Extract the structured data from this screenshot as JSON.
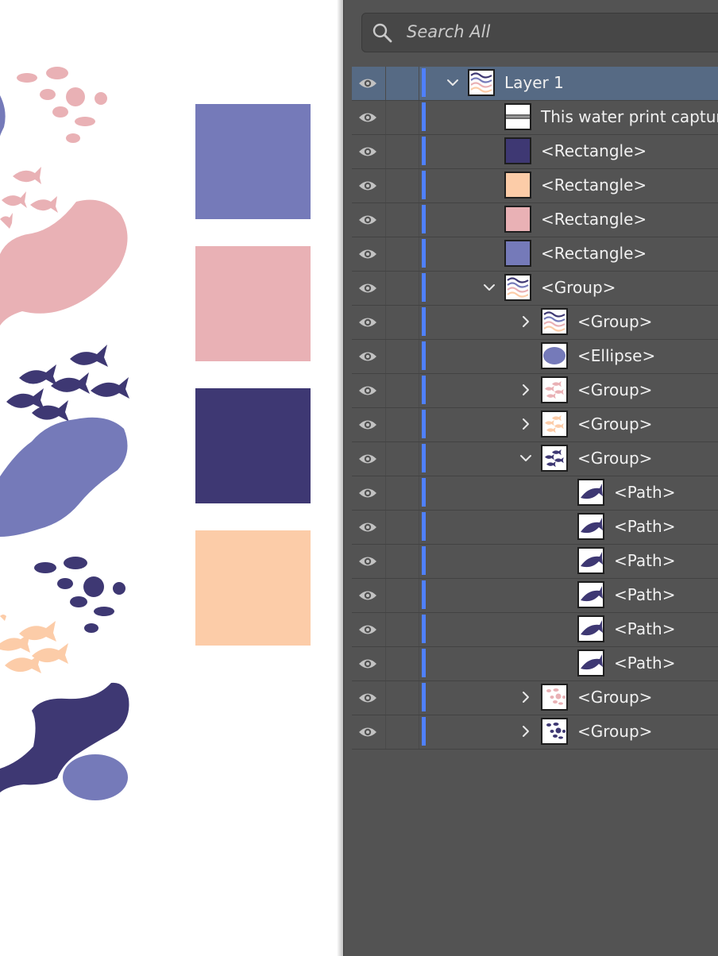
{
  "colors": {
    "periwinkle": "#757ab9",
    "pink": "#e9b1b5",
    "navy": "#3e3873",
    "peach": "#fccca8",
    "panel_bg": "#535353",
    "selection": "#566a84",
    "layer_bar": "#4f80ff"
  },
  "canvas": {
    "swatches": [
      "periwinkle",
      "pink",
      "navy",
      "peach"
    ]
  },
  "layers_panel": {
    "search_placeholder": "Search All",
    "rows": [
      {
        "label": "Layer 1",
        "indent": 0,
        "twisty": "down",
        "thumb": "pattern",
        "selected": true
      },
      {
        "label": "This water print capture",
        "indent": 1,
        "twisty": "",
        "thumb": "strip"
      },
      {
        "label": "<Rectangle>",
        "indent": 1,
        "twisty": "",
        "thumb": "navy"
      },
      {
        "label": "<Rectangle>",
        "indent": 1,
        "twisty": "",
        "thumb": "peach"
      },
      {
        "label": "<Rectangle>",
        "indent": 1,
        "twisty": "",
        "thumb": "pink"
      },
      {
        "label": "<Rectangle>",
        "indent": 1,
        "twisty": "",
        "thumb": "periwinkle"
      },
      {
        "label": "<Group>",
        "indent": 1,
        "twisty": "down",
        "thumb": "pattern"
      },
      {
        "label": "<Group>",
        "indent": 2,
        "twisty": "right",
        "thumb": "pattern"
      },
      {
        "label": "<Ellipse>",
        "indent": 2,
        "twisty": "",
        "thumb": "ellipse"
      },
      {
        "label": "<Group>",
        "indent": 2,
        "twisty": "right",
        "thumb": "pinkfish"
      },
      {
        "label": "<Group>",
        "indent": 2,
        "twisty": "right",
        "thumb": "peachfish"
      },
      {
        "label": "<Group>",
        "indent": 2,
        "twisty": "down",
        "thumb": "navyfish"
      },
      {
        "label": "<Path>",
        "indent": 3,
        "twisty": "",
        "thumb": "fish"
      },
      {
        "label": "<Path>",
        "indent": 3,
        "twisty": "",
        "thumb": "fish"
      },
      {
        "label": "<Path>",
        "indent": 3,
        "twisty": "",
        "thumb": "fish"
      },
      {
        "label": "<Path>",
        "indent": 3,
        "twisty": "",
        "thumb": "fish"
      },
      {
        "label": "<Path>",
        "indent": 3,
        "twisty": "",
        "thumb": "fish"
      },
      {
        "label": "<Path>",
        "indent": 3,
        "twisty": "",
        "thumb": "fish"
      },
      {
        "label": "<Group>",
        "indent": 2,
        "twisty": "right",
        "thumb": "pinkdots"
      },
      {
        "label": "<Group>",
        "indent": 2,
        "twisty": "right",
        "thumb": "navydots"
      }
    ]
  }
}
